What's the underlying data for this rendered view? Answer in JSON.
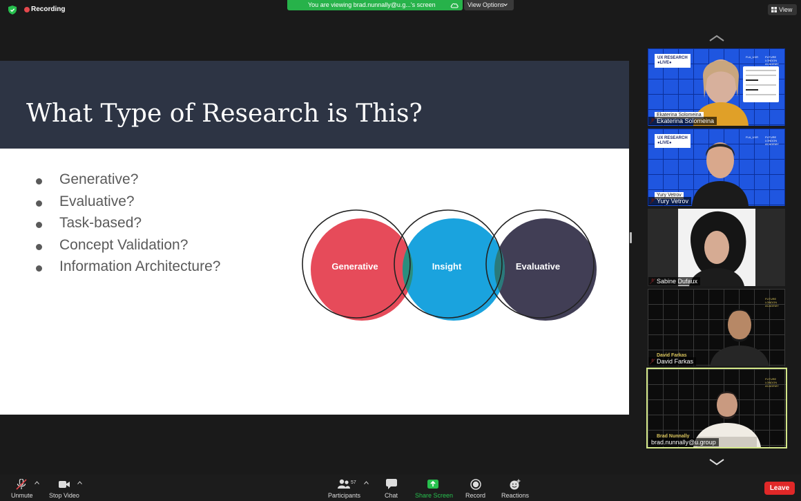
{
  "topbar": {
    "recording_label": "Recording",
    "share_banner": "You are viewing brad.nunnally@u.g...'s screen",
    "view_options_label": "View Options",
    "view_label": "View"
  },
  "slide": {
    "title": "What Type of Research is This?",
    "bullets": [
      "Generative?",
      "Evaluative?",
      "Task-based?",
      "Concept Validation?",
      "Information Architecture?"
    ],
    "venn": {
      "circles": [
        {
          "label": "Generative",
          "color": "#e64b5a"
        },
        {
          "label": "Insight",
          "color": "#1aa3de"
        },
        {
          "label": "Evaluative",
          "color": "#413e55"
        }
      ],
      "overlap_color": "#2a8e7e"
    }
  },
  "gallery": {
    "tiles": [
      {
        "name": "Ekaterina Solomeina",
        "overlay": "Ekaterina Solomeina",
        "muted": true
      },
      {
        "name": "Yury Vetrov",
        "overlay": "Yury Vetrov",
        "muted": true
      },
      {
        "name": "Sabine Dufaux",
        "muted": true
      },
      {
        "name": "David Farkas",
        "overlay": "David Farkas",
        "muted": true
      },
      {
        "name": "brad.nunnally@u.group",
        "overlay": "Brad Nunnally",
        "muted": false,
        "active": true
      }
    ],
    "brand": {
      "line1": "UX RESEARCH",
      "line2": "●LIVE●",
      "fla": "FLA_UXR",
      "academy": "FUTURE LONDON ACADEMY"
    }
  },
  "toolbar": {
    "unmute_label": "Unmute",
    "stop_video_label": "Stop Video",
    "participants_label": "Participants",
    "participants_count": "57",
    "chat_label": "Chat",
    "share_screen_label": "Share Screen",
    "record_label": "Record",
    "reactions_label": "Reactions",
    "leave_label": "Leave"
  },
  "colors": {
    "slide_header": "#2d3444",
    "share_green": "#27b24a",
    "leave_red": "#e02828",
    "active_border": "#d4e88a"
  }
}
